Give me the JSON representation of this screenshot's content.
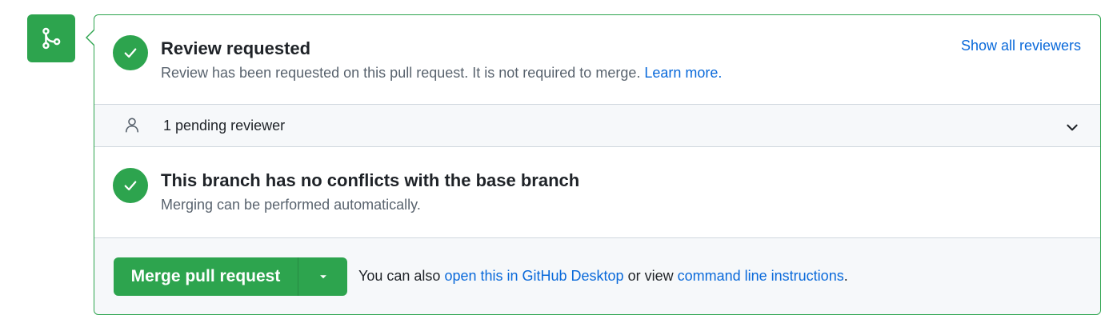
{
  "colors": {
    "success": "#2da44e",
    "link": "#0969da",
    "muted": "#59636e"
  },
  "timeline_icon": "git-merge-icon",
  "review": {
    "icon": "check-icon",
    "title": "Review requested",
    "description": "Review has been requested on this pull request. It is not required to merge.",
    "learn_more": "Learn more.",
    "show_all": "Show all reviewers"
  },
  "pending": {
    "icon": "person-icon",
    "label": "1 pending reviewer",
    "expand_icon": "chevron-down-icon"
  },
  "conflicts": {
    "icon": "check-icon",
    "title": "This branch has no conflicts with the base branch",
    "description": "Merging can be performed automatically."
  },
  "merge": {
    "button_label": "Merge pull request",
    "dropdown_icon": "triangle-down-icon",
    "hint_prefix": "You can also",
    "desktop_link": "open this in GitHub Desktop",
    "hint_middle": "or view",
    "cli_link": "command line instructions",
    "hint_suffix": "."
  }
}
